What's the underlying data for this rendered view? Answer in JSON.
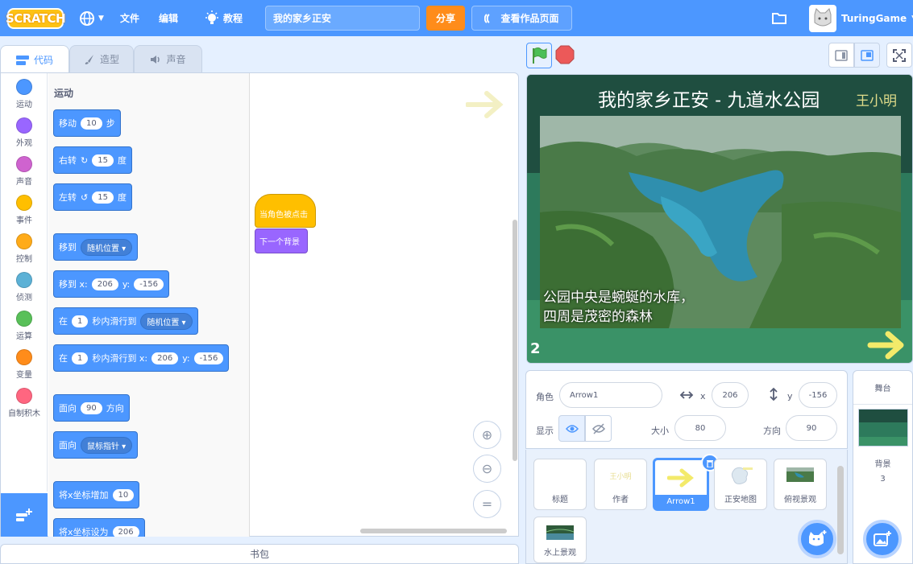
{
  "menubar": {
    "logo": "SCRATCH",
    "file": "文件",
    "edit": "编辑",
    "tutorials": "教程",
    "project_title": "我的家乡正安",
    "share": "分享",
    "see_project": "查看作品页面",
    "username": "TuringGame"
  },
  "tabs": {
    "code": "代码",
    "costumes": "造型",
    "sounds": "声音"
  },
  "categories": [
    {
      "label": "运动",
      "color": "#4c97ff"
    },
    {
      "label": "外观",
      "color": "#9966ff"
    },
    {
      "label": "声音",
      "color": "#cf63cf"
    },
    {
      "label": "事件",
      "color": "#ffbf00"
    },
    {
      "label": "控制",
      "color": "#ffab19"
    },
    {
      "label": "侦测",
      "color": "#5cb1d6"
    },
    {
      "label": "运算",
      "color": "#59c059"
    },
    {
      "label": "变量",
      "color": "#ff8c1a"
    },
    {
      "label": "自制积木",
      "color": "#ff6680"
    }
  ],
  "palette": {
    "section": "运动",
    "move": {
      "pre": "移动",
      "val": "10",
      "post": "步"
    },
    "turn_right": {
      "pre": "右转",
      "val": "15",
      "post": "度"
    },
    "turn_left": {
      "pre": "左转",
      "val": "15",
      "post": "度"
    },
    "goto": {
      "pre": "移到",
      "dd": "随机位置"
    },
    "goto_xy": {
      "pre": "移到 x:",
      "x": "206",
      "ylbl": "y:",
      "y": "-156"
    },
    "glide": {
      "pre": "在",
      "val": "1",
      "mid": "秒内滑行到",
      "dd": "随机位置"
    },
    "glide_xy": {
      "pre": "在",
      "val": "1",
      "mid": "秒内滑行到 x:",
      "x": "206",
      "ylbl": "y:",
      "y": "-156"
    },
    "point_dir": {
      "pre": "面向",
      "val": "90",
      "post": "方向"
    },
    "point_towards": {
      "pre": "面向",
      "dd": "鼠标指针"
    },
    "change_x": {
      "pre": "将x坐标增加",
      "val": "10"
    },
    "set_x": {
      "pre": "将x坐标设为",
      "val": "206"
    }
  },
  "script": {
    "hat": "当角色被点击",
    "next": "下一个背景"
  },
  "backpack": "书包",
  "stage": {
    "title": "我的家乡正安 - 九道水公园",
    "author": "王小明",
    "caption_line1": "公园中央是蜿蜒的水库，",
    "caption_line2": "四周是茂密的森林",
    "page_number": "2"
  },
  "sprite_info": {
    "sprite_label": "角色",
    "sprite_name": "Arrow1",
    "x_label": "x",
    "x": "206",
    "y_label": "y",
    "y": "-156",
    "show_label": "显示",
    "size_label": "大小",
    "size": "80",
    "direction_label": "方向",
    "direction": "90"
  },
  "sprites": [
    {
      "name": "标题"
    },
    {
      "name": "作者",
      "preview": "王小明"
    },
    {
      "name": "Arrow1"
    },
    {
      "name": "正安地图"
    },
    {
      "name": "俯视景观"
    },
    {
      "name": "水上景观"
    }
  ],
  "stage_panel": {
    "header": "舞台",
    "backdrops_label": "背景",
    "backdrops_count": "3"
  }
}
